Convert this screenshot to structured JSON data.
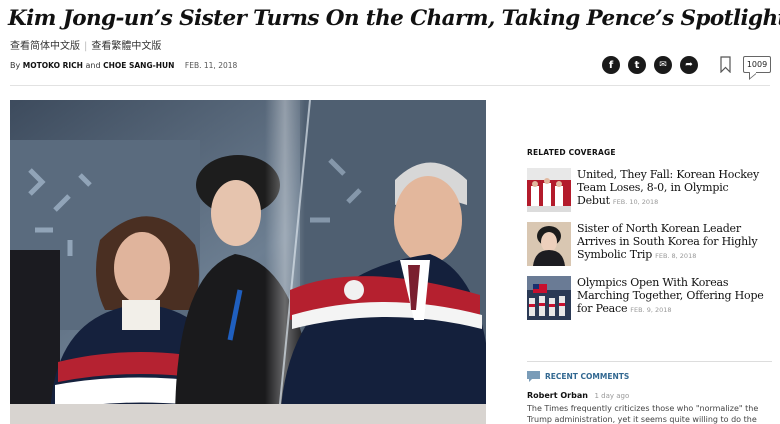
{
  "article": {
    "headline": "Kim Jong-un’s Sister Turns On the Charm, Taking Pence’s Spotlight",
    "lang_simplified": "查看简体中文版",
    "lang_traditional": "查看繁體中文版",
    "byline_prefix": "By",
    "author1": "MOTOKO RICH",
    "byline_and": "and",
    "author2": "CHOE SANG-HUN",
    "date": "FEB. 11, 2018"
  },
  "share": {
    "facebook_glyph": "f",
    "twitter_glyph": "t",
    "email_glyph": "✉",
    "share_glyph": "➦",
    "comment_count": "1009"
  },
  "related": {
    "title": "RELATED COVERAGE",
    "items": [
      {
        "headline": "United, They Fall: Korean Hockey Team Loses, 8-0, in Olympic Debut",
        "date": "FEB. 10, 2018",
        "thumb": "hockey-team-photo"
      },
      {
        "headline": "Sister of North Korean Leader Arrives in South Korea for Highly Symbolic Trip",
        "date": "FEB. 8, 2018",
        "thumb": "kim-yo-jong-photo"
      },
      {
        "headline": "Olympics Open With Koreas Marching Together, Offering Hope for Peace",
        "date": "FEB. 9, 2018",
        "thumb": "opening-ceremony-photo"
      }
    ]
  },
  "recent_comments": {
    "title": "RECENT COMMENTS",
    "commenter": "Robert Orban",
    "ago": "1 day ago",
    "text": "The Times frequently criticizes those who \"normalize\" the Trump administration, yet it seems quite willing to do the same for Kim"
  },
  "colors": {
    "headline": "#111111",
    "link_blue": "#326891",
    "share_icon_bg": "#1a1a1a",
    "muted_date": "#999999"
  }
}
